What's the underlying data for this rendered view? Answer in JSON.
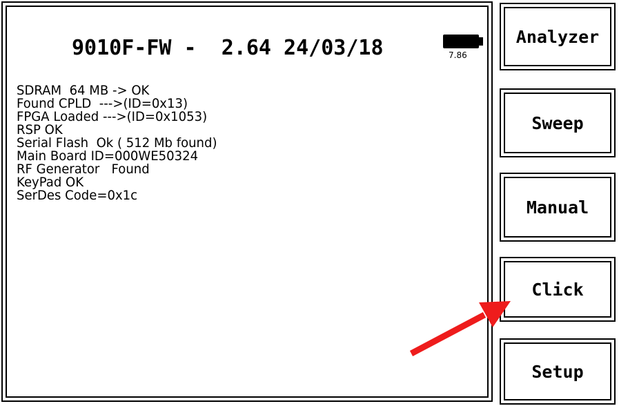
{
  "header": {
    "title": "9010F-FW -  2.64 24/03/18",
    "battery_voltage": "7.86",
    "battery_icon": "battery-icon"
  },
  "log": {
    "lines": [
      "SDRAM  64 MB -> OK",
      "Found CPLD  --->(ID=0x13)",
      "FPGA Loaded --->(ID=0x1053)",
      "RSP OK",
      "Serial Flash  Ok ( 512 Mb found)",
      "Main Board ID=000WE50324",
      "RF Generator   Found",
      "KeyPad OK",
      "SerDes Code=0x1c"
    ]
  },
  "softkeys": {
    "analyzer": "Analyzer",
    "sweep": "Sweep",
    "manual": "Manual",
    "click": "Click",
    "setup": "Setup"
  },
  "annotation": {
    "arrow_icon": "arrow-icon",
    "arrow_color": "#ee1c1c"
  }
}
